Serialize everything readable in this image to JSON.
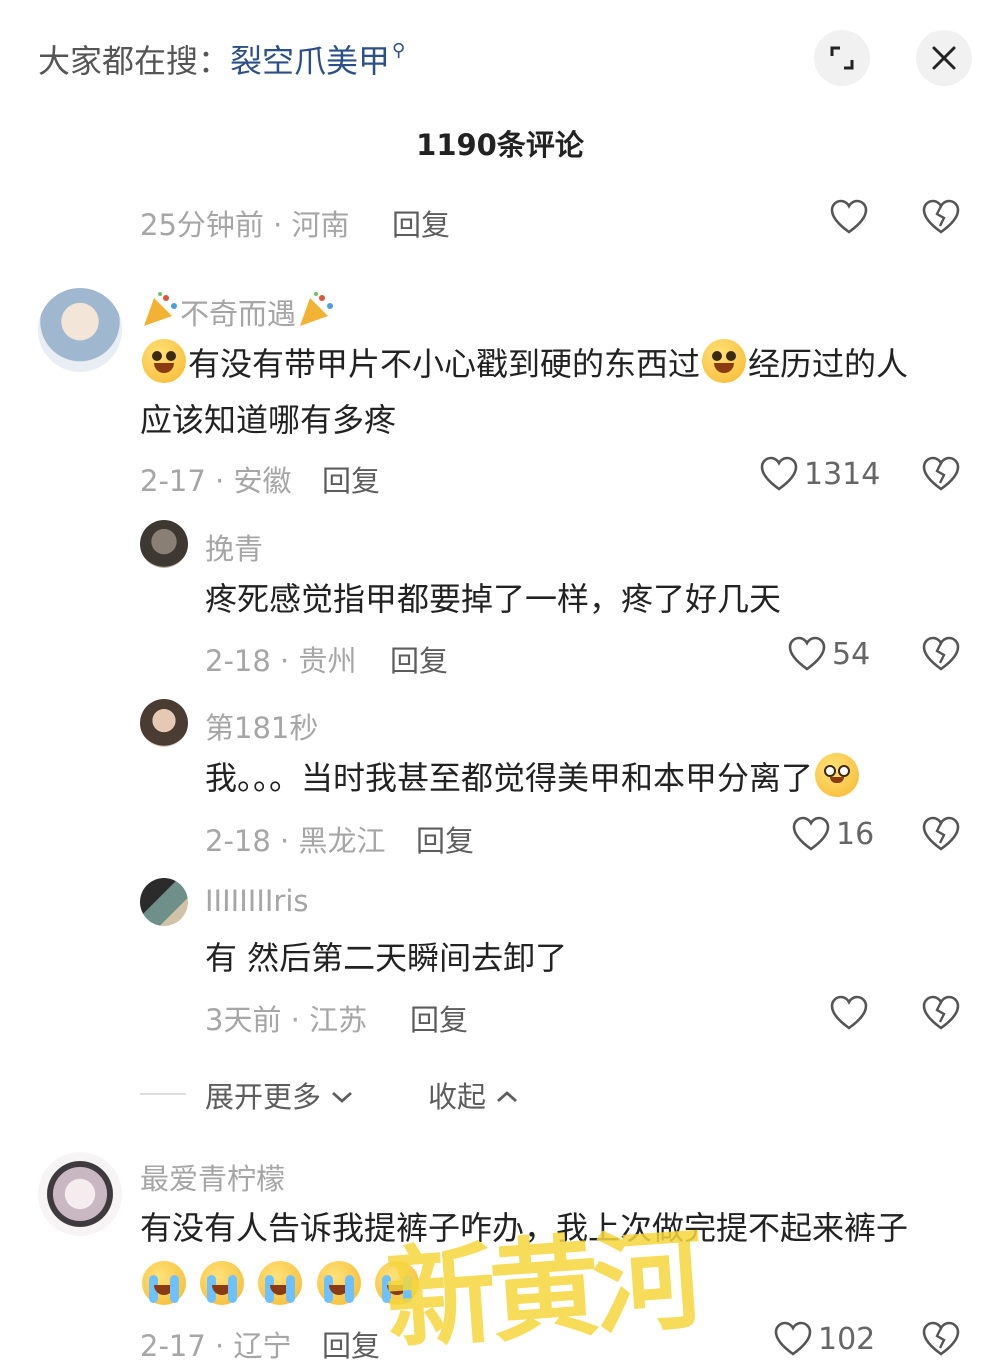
{
  "search_hint": {
    "prefix": "大家都在搜：",
    "keyword": "裂空爪美甲"
  },
  "header": {
    "comment_count_title": "1190条评论"
  },
  "top_comment_meta": {
    "meta": "25分钟前 · 河南",
    "reply_label": "回复"
  },
  "comments": [
    {
      "username": "不奇而遇",
      "text_line1_a": "有没有带甲片不小心戳到硬的东西过",
      "text_line1_b": "经历过的人",
      "text_line2": "应该知道哪有多疼",
      "meta": "2-17 · 安徽",
      "reply_label": "回复",
      "likes": "1314",
      "replies": [
        {
          "username": "挽青",
          "text": "疼死感觉指甲都要掉了一样，疼了好几天",
          "meta": "2-18 · 贵州",
          "reply_label": "回复",
          "likes": "54"
        },
        {
          "username": "第181秒",
          "text": "我。。。当时我甚至都觉得美甲和本甲分离了",
          "meta": "2-18 · 黑龙江",
          "reply_label": "回复",
          "likes": "16"
        },
        {
          "username": "IIIIIIIIris",
          "text": "有 然后第二天瞬间去卸了",
          "meta": "3天前 · 江苏",
          "reply_label": "回复",
          "likes": ""
        }
      ],
      "expand_more_label": "展开更多",
      "collapse_label": "收起"
    },
    {
      "username": "最爱青柠檬",
      "text_line1": "有没有人告诉我提裤子咋办，我上次做完提不起来裤子",
      "meta": "2-17 · 辽宁",
      "reply_label": "回复",
      "likes": "102"
    }
  ],
  "watermark_text": "新黄河",
  "colors": {
    "keyword": "#2c4f8a",
    "meta_gray": "#a6a6a6",
    "watermark": "#f5d63c"
  }
}
